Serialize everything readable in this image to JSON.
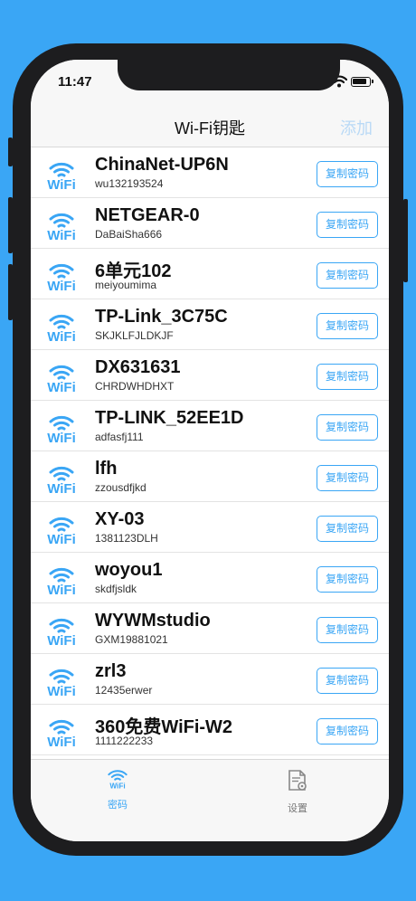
{
  "status_bar": {
    "time": "11:47"
  },
  "nav": {
    "title": "Wi-Fi钥匙",
    "add_label": "添加"
  },
  "colors": {
    "accent": "#3aa6f5",
    "background": "#3aa6f5",
    "add_disabled": "#b9d9f6"
  },
  "list": {
    "icon": "wifi-logo-icon",
    "copy_label": "复制密码",
    "items": [
      {
        "ssid": "ChinaNet-UP6N",
        "password": "wu132193524"
      },
      {
        "ssid": "NETGEAR-0",
        "password": "DaBaiSha666"
      },
      {
        "ssid": "6单元102",
        "password": "meiyoumima"
      },
      {
        "ssid": "TP-Link_3C75C",
        "password": "SKJKLFJLDKJF"
      },
      {
        "ssid": "DX631631",
        "password": "CHRDWHDHXT"
      },
      {
        "ssid": "TP-LINK_52EE1D",
        "password": "adfasfj111"
      },
      {
        "ssid": "lfh",
        "password": "zzousdfjkd"
      },
      {
        "ssid": "XY-03",
        "password": "1381123DLH"
      },
      {
        "ssid": "woyou1",
        "password": "skdfjsldk"
      },
      {
        "ssid": "WYWMstudio",
        "password": "GXM19881021"
      },
      {
        "ssid": "zrl3",
        "password": "12435erwer"
      },
      {
        "ssid": "360免费WiFi-W2",
        "password": "1111222233"
      }
    ]
  },
  "tab_bar": {
    "keys_label": "密码",
    "keys_icon": "wifi-logo-icon",
    "settings_label": "设置",
    "settings_icon": "document-settings-icon"
  }
}
